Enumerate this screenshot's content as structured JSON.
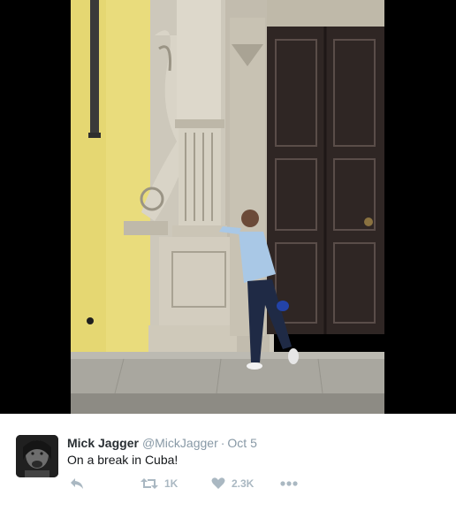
{
  "media": {
    "icon": "photo"
  },
  "tweet": {
    "display_name": "Mick Jagger",
    "handle": "@MickJagger",
    "separator": "·",
    "timestamp": "Oct 5",
    "text": "On a break in Cuba!"
  },
  "actions": {
    "reply_icon": "reply-icon",
    "retweet_icon": "retweet-icon",
    "retweet_count": "1K",
    "like_icon": "heart-icon",
    "like_count": "2.3K",
    "more_icon": "more-icon"
  },
  "colors": {
    "media_background": "#000000",
    "name": "#292f33",
    "secondary_text": "#8899a6",
    "action_icons": "#aab8c2"
  }
}
